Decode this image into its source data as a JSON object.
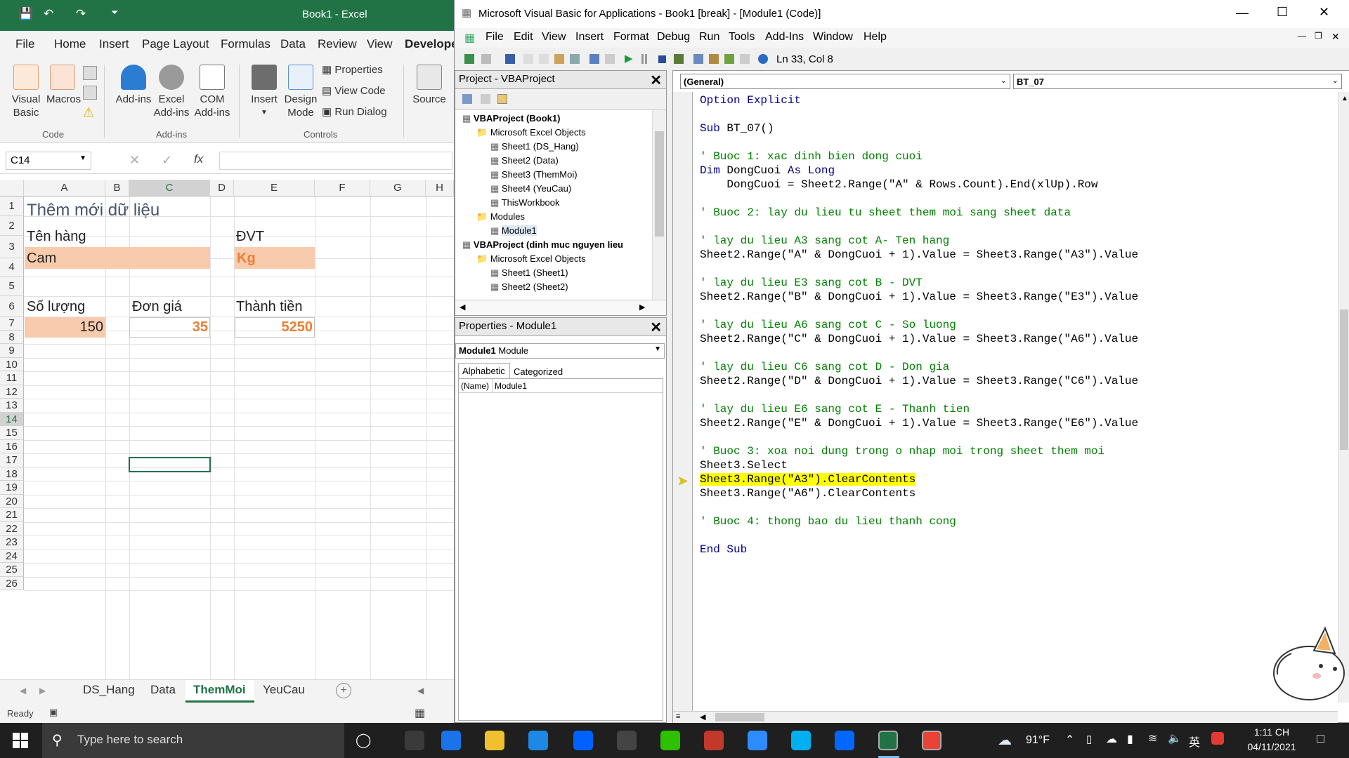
{
  "excel": {
    "title": "Book1  -  Excel",
    "tabs": [
      "File",
      "Home",
      "Insert",
      "Page Layout",
      "Formulas",
      "Data",
      "Review",
      "View",
      "Develope"
    ],
    "ribbon": {
      "visual_basic": "Visual Basic",
      "macros": "Macros",
      "add_ins": "Add-ins",
      "excel_add_ins": "Excel Add-ins",
      "com_add_ins": "COM Add-ins",
      "insert": "Insert",
      "design_mode": "Design Mode",
      "properties": "Properties",
      "view_code": "View Code",
      "run_dialog": "Run Dialog",
      "source": "Source",
      "group_code": "Code",
      "group_addins": "Add-ins",
      "group_controls": "Controls"
    },
    "name_box": "C14",
    "fx": "fx",
    "columns": [
      "A",
      "B",
      "C",
      "D",
      "E",
      "F",
      "G",
      "H"
    ],
    "rows": [
      "1",
      "2",
      "3",
      "4",
      "5",
      "6",
      "7",
      "8",
      "9",
      "10",
      "11",
      "12",
      "13",
      "14",
      "15",
      "16",
      "17",
      "18",
      "19",
      "20",
      "21",
      "22",
      "23",
      "24",
      "25",
      "26"
    ],
    "cells": {
      "a1": "Thêm mới dữ liệu",
      "a2": "Tên hàng",
      "e2": "ĐVT",
      "a3": "Cam",
      "e3": "Kg",
      "a5": "Số lượng",
      "c5": "Đơn giá",
      "e5": "Thành tiền",
      "a6": "150",
      "c6": "35",
      "e6": "5250"
    },
    "sheet_tabs": [
      "DS_Hang",
      "Data",
      "ThemMoi",
      "YeuCau"
    ],
    "active_sheet": "ThemMoi",
    "status": "Ready"
  },
  "vbe": {
    "title": "Microsoft Visual Basic for Applications - Book1 [break] - [Module1 (Code)]",
    "menu": [
      "File",
      "Edit",
      "View",
      "Insert",
      "Format",
      "Debug",
      "Run",
      "Tools",
      "Add-Ins",
      "Window",
      "Help"
    ],
    "position": "Ln 33, Col 8",
    "project_title": "Project - VBAProject",
    "tree": [
      "VBAProject (Book1)",
      "Microsoft Excel Objects",
      "Sheet1 (DS_Hang)",
      "Sheet2 (Data)",
      "Sheet3 (ThemMoi)",
      "Sheet4 (YeuCau)",
      "ThisWorkbook",
      "Modules",
      "Module1",
      "VBAProject (dinh muc nguyen lieu",
      "Microsoft Excel Objects",
      "Sheet1 (Sheet1)",
      "Sheet2 (Sheet2)"
    ],
    "props_title": "Properties - Module1",
    "props_object": "Module1",
    "props_object_type": "Module",
    "props_tab_alpha": "Alphabetic",
    "props_tab_cat": "Categorized",
    "props_name_key": "(Name)",
    "props_name_val": "Module1",
    "object_combo": "(General)",
    "proc_combo": "BT_07",
    "code_lines": [
      {
        "t": "Option Explicit",
        "c": "kw"
      },
      {
        "t": "",
        "c": "tx"
      },
      {
        "t": "Sub BT_07()",
        "c": "mix1"
      },
      {
        "t": "",
        "c": "tx"
      },
      {
        "t": "' Buoc 1: xac dinh bien dong cuoi",
        "c": "cm"
      },
      {
        "t": "Dim DongCuoi As Long",
        "c": "mix2"
      },
      {
        "t": "    DongCuoi = Sheet2.Range(\"A\" & Rows.Count).End(xlUp).Row",
        "c": "tx"
      },
      {
        "t": "",
        "c": "tx"
      },
      {
        "t": "' Buoc 2: lay du lieu tu sheet them moi sang sheet data",
        "c": "cm"
      },
      {
        "t": "",
        "c": "tx"
      },
      {
        "t": "' lay du lieu A3 sang cot A- Ten hang",
        "c": "cm"
      },
      {
        "t": "Sheet2.Range(\"A\" & DongCuoi + 1).Value = Sheet3.Range(\"A3\").Value",
        "c": "tx"
      },
      {
        "t": "",
        "c": "tx"
      },
      {
        "t": "' lay du lieu E3 sang cot B - DVT",
        "c": "cm"
      },
      {
        "t": "Sheet2.Range(\"B\" & DongCuoi + 1).Value = Sheet3.Range(\"E3\").Value",
        "c": "tx"
      },
      {
        "t": "",
        "c": "tx"
      },
      {
        "t": "' lay du lieu A6 sang cot C - So luong",
        "c": "cm"
      },
      {
        "t": "Sheet2.Range(\"C\" & DongCuoi + 1).Value = Sheet3.Range(\"A6\").Value",
        "c": "tx"
      },
      {
        "t": "",
        "c": "tx"
      },
      {
        "t": "' lay du lieu C6 sang cot D - Don gia",
        "c": "cm"
      },
      {
        "t": "Sheet2.Range(\"D\" & DongCuoi + 1).Value = Sheet3.Range(\"C6\").Value",
        "c": "tx"
      },
      {
        "t": "",
        "c": "tx"
      },
      {
        "t": "' lay du lieu E6 sang cot E - Thanh tien",
        "c": "cm"
      },
      {
        "t": "Sheet2.Range(\"E\" & DongCuoi + 1).Value = Sheet3.Range(\"E6\").Value",
        "c": "tx"
      },
      {
        "t": "",
        "c": "tx"
      },
      {
        "t": "' Buoc 3: xoa noi dung trong o nhap moi trong sheet them moi",
        "c": "cm"
      },
      {
        "t": "Sheet3.Select",
        "c": "tx"
      },
      {
        "t": "Sheet3.Range(\"A3\").ClearContents",
        "c": "hl"
      },
      {
        "t": "Sheet3.Range(\"A6\").ClearContents",
        "c": "tx"
      },
      {
        "t": "",
        "c": "tx"
      },
      {
        "t": "' Buoc 4: thong bao du lieu thanh cong",
        "c": "cm"
      },
      {
        "t": "",
        "c": "tx"
      },
      {
        "t": "End Sub",
        "c": "kw"
      }
    ]
  },
  "taskbar": {
    "search_placeholder": "Type here to search",
    "weather": "91°F",
    "ime": "英",
    "time": "1:11 CH",
    "date": "04/11/2021",
    "apps": [
      "task-view-icon",
      "edge-icon",
      "file-explorer-icon",
      "mail-icon",
      "dropbox-icon",
      "app-icon",
      "wechat-icon",
      "app2-icon",
      "zoom-icon",
      "skype-icon",
      "zalo-icon",
      "excel-icon",
      "chrome-icon"
    ]
  },
  "colors": {
    "excel_green": "#217346",
    "orange_fill": "#f8cbad",
    "orange_text": "#ed7d31",
    "code_keyword": "#00008b",
    "code_comment": "#008000",
    "highlight": "#ffff00"
  }
}
